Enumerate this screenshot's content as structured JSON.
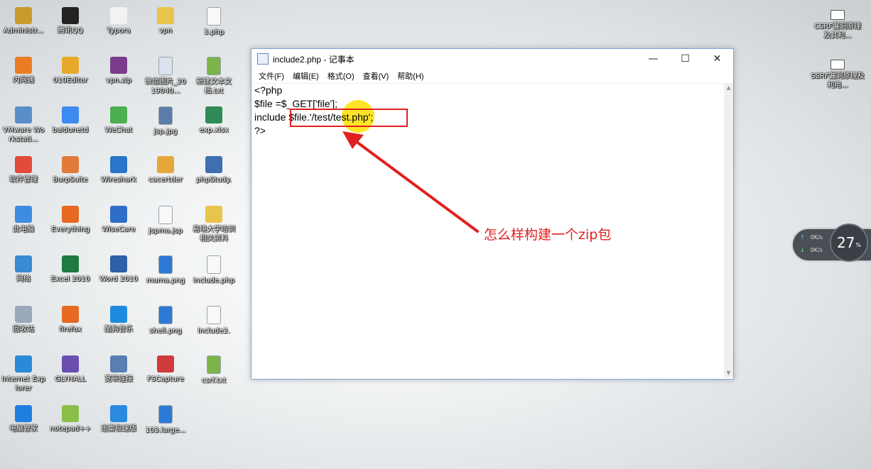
{
  "desktop_icons": [
    {
      "label": "Administr...",
      "icon": "user-folder-icon",
      "color": "#c99b2f"
    },
    {
      "label": "腾讯QQ",
      "icon": "qq-penguin-icon",
      "color": "#222222"
    },
    {
      "label": "Typora",
      "icon": "typora-icon",
      "color": "#f2f2f2"
    },
    {
      "label": "vpn",
      "icon": "folder-icon",
      "color": "#e9c44a"
    },
    {
      "label": "3.php",
      "icon": "file-icon",
      "color": "#f8f8f8"
    },
    {
      "label": "内网通",
      "icon": "neiwangtong-icon",
      "color": "#ea7d23"
    },
    {
      "label": "010Editor",
      "icon": "010editor-icon",
      "color": "#e8a92a"
    },
    {
      "label": "vpn.zip",
      "icon": "zip-archive-icon",
      "color": "#7a3c8c"
    },
    {
      "label": "微信图片_2019040...",
      "icon": "image-file-icon",
      "color": "#d9e4ef"
    },
    {
      "label": "新建文本文档.txt",
      "icon": "text-file-icon",
      "color": "#7ab44a"
    },
    {
      "label": "VMware Workstati...",
      "icon": "vmware-icon",
      "color": "#5a8ec7"
    },
    {
      "label": "baidunetd",
      "icon": "baidunetdisk-icon",
      "color": "#3d8af0"
    },
    {
      "label": "WeChat",
      "icon": "wechat-icon",
      "color": "#4caf50"
    },
    {
      "label": "jsp.jpg",
      "icon": "image-file-icon",
      "color": "#5b7ca8"
    },
    {
      "label": "exp.xlsx",
      "icon": "excel-file-icon",
      "color": "#2e8b57"
    },
    {
      "label": "软件管理",
      "icon": "software-manager-icon",
      "color": "#e24a3b"
    },
    {
      "label": "BurpSuite",
      "icon": "burpsuite-icon",
      "color": "#e27a3a"
    },
    {
      "label": "Wireshark",
      "icon": "wireshark-icon",
      "color": "#2a74c9"
    },
    {
      "label": "cacertder",
      "icon": "certificate-icon",
      "color": "#e6a73a"
    },
    {
      "label": "phpStudy.",
      "icon": "phpstudy-icon",
      "color": "#3f6fb0"
    },
    {
      "label": "此电脑",
      "icon": "computer-icon",
      "color": "#3d8ce0"
    },
    {
      "label": "Everything",
      "icon": "everything-search-icon",
      "color": "#e56a1f"
    },
    {
      "label": "WiseCare",
      "icon": "wisecare-icon",
      "color": "#2e6ec7"
    },
    {
      "label": "jspma.jsp",
      "icon": "file-icon",
      "color": "#f8f8f8"
    },
    {
      "label": "易境大学培训相关资料",
      "icon": "folder-icon",
      "color": "#e9c44a"
    },
    {
      "label": "网络",
      "icon": "network-icon",
      "color": "#3a8ad4"
    },
    {
      "label": "Excel 2010",
      "icon": "excel-icon",
      "color": "#1f7a3f"
    },
    {
      "label": "Word 2010",
      "icon": "word-icon",
      "color": "#2b5fa8"
    },
    {
      "label": "muma.png",
      "icon": "image-file-icon",
      "color": "#2d7ad6"
    },
    {
      "label": "include.php",
      "icon": "file-icon",
      "color": "#f8f8f8"
    },
    {
      "label": "回收站",
      "icon": "recycle-bin-icon",
      "color": "#9aa9b8"
    },
    {
      "label": "firefox",
      "icon": "firefox-icon",
      "color": "#e66a21"
    },
    {
      "label": "酷狗音乐",
      "icon": "kugou-icon",
      "color": "#1f8be0"
    },
    {
      "label": "shell.png",
      "icon": "image-file-icon",
      "color": "#2d7ad6"
    },
    {
      "label": "include2.",
      "icon": "file-icon",
      "color": "#f8f8f8"
    },
    {
      "label": "Internet Explorer",
      "icon": "ie-icon",
      "color": "#2a8ad8"
    },
    {
      "label": "GLYHALL",
      "icon": "glyhall-icon",
      "color": "#6a4fb0"
    },
    {
      "label": "宽带连接",
      "icon": "broadband-icon",
      "color": "#5a7fb0"
    },
    {
      "label": "FSCapture",
      "icon": "fscapture-icon",
      "color": "#d13a3a"
    },
    {
      "label": "csrf.txt",
      "icon": "text-file-icon",
      "color": "#7ab44a"
    },
    {
      "label": "电脑管家",
      "icon": "pc-manager-icon",
      "color": "#1e7fe0"
    },
    {
      "label": "notepad++",
      "icon": "notepadpp-icon",
      "color": "#8bbf4a"
    },
    {
      "label": "迅雷极速版",
      "icon": "xunlei-icon",
      "color": "#2b8ae0"
    },
    {
      "label": "103.large...",
      "icon": "image-file-icon",
      "color": "#2d7ad6"
    }
  ],
  "right_icons": [
    {
      "label": "CSRF漏洞原理及其利...",
      "icon": "window-file-icon"
    },
    {
      "label": "SSRF漏洞原理及利用...",
      "icon": "window-file-icon"
    }
  ],
  "notepad": {
    "title": "include2.php - 记事本",
    "menus": [
      "文件(F)",
      "编辑(E)",
      "格式(O)",
      "查看(V)",
      "帮助(H)"
    ],
    "lines": [
      "<?php",
      "$file =$_GET['file'];",
      "include $file.'/test/test.php';",
      "?>"
    ]
  },
  "annotation": "怎么样构建一个zip包",
  "speed_widget": {
    "upload": "0K/s",
    "download": "0K/s",
    "percent": "27",
    "percent_unit": "%"
  }
}
